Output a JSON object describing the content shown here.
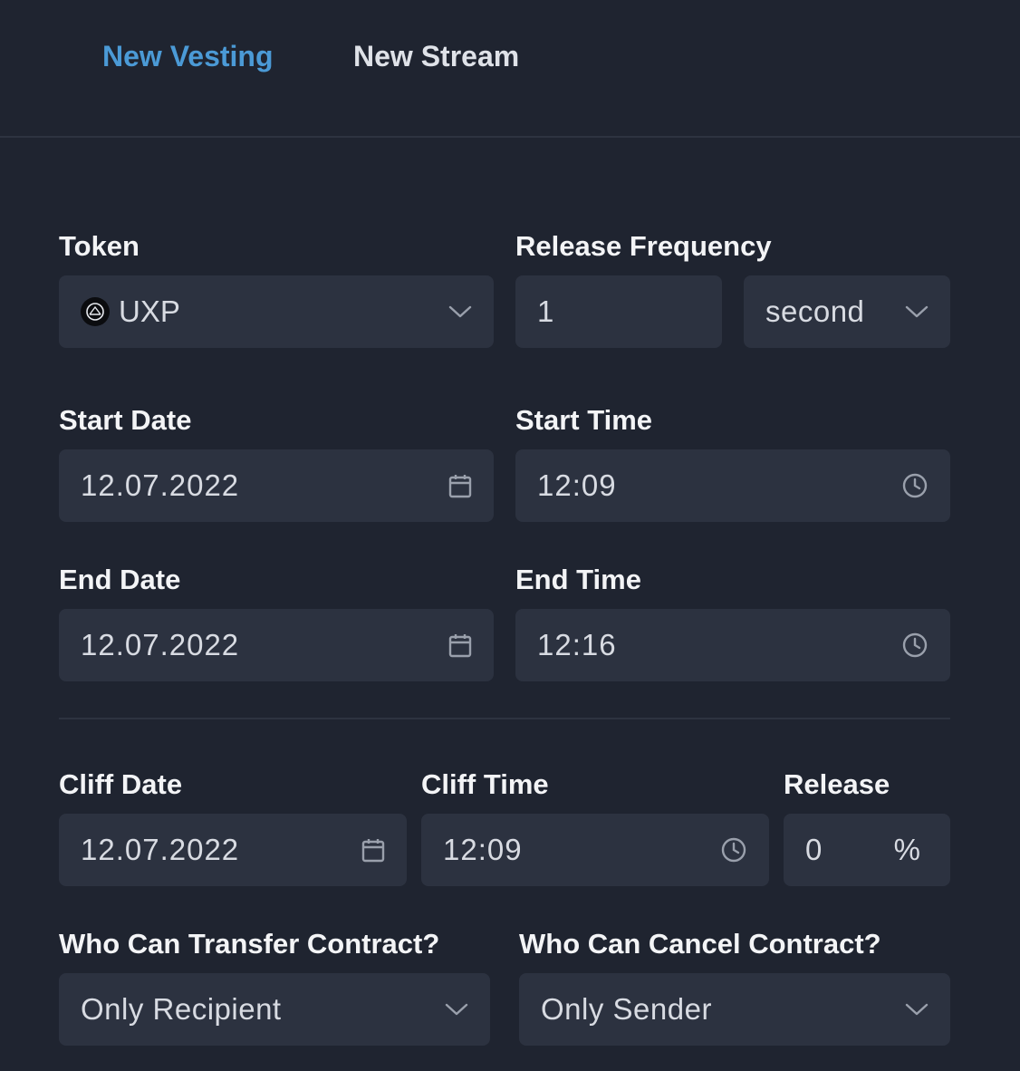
{
  "tabs": [
    {
      "label": "New Vesting",
      "active": true
    },
    {
      "label": "New Stream",
      "active": false
    }
  ],
  "token": {
    "label": "Token",
    "value": "UXP",
    "icon": "uxp-token-icon"
  },
  "release_frequency": {
    "label": "Release Frequency",
    "amount": "1",
    "unit": "second"
  },
  "start_date": {
    "label": "Start Date",
    "value": "12.07.2022"
  },
  "start_time": {
    "label": "Start Time",
    "value": "12:09"
  },
  "end_date": {
    "label": "End Date",
    "value": "12.07.2022"
  },
  "end_time": {
    "label": "End Time",
    "value": "12:16"
  },
  "cliff_date": {
    "label": "Cliff Date",
    "value": "12.07.2022"
  },
  "cliff_time": {
    "label": "Cliff Time",
    "value": "12:09"
  },
  "release": {
    "label": "Release",
    "value": "0",
    "unit": "%"
  },
  "transfer": {
    "label": "Who Can Transfer Contract?",
    "value": "Only Recipient"
  },
  "cancel": {
    "label": "Who Can Cancel Contract?",
    "value": "Only Sender"
  },
  "colors": {
    "background": "#1f2430",
    "field": "#2c3240",
    "accent": "#4b9ad6"
  }
}
